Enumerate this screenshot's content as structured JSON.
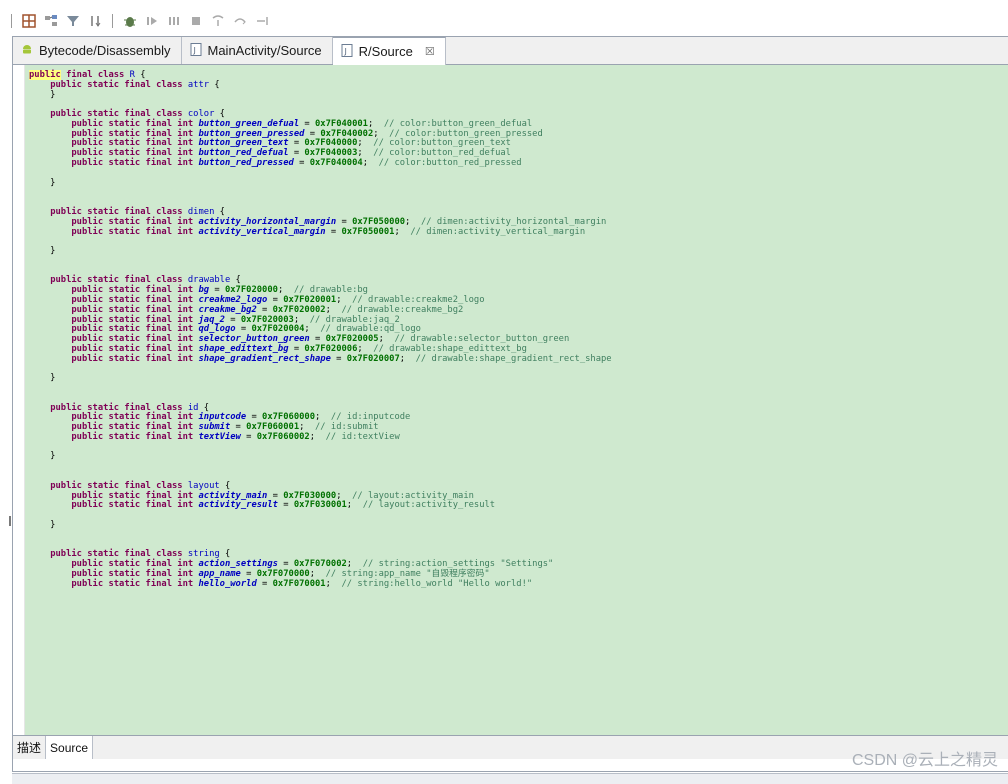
{
  "toolbar": {
    "icons": [
      "separator-mark",
      "grid-icon",
      "hierarchy-icon",
      "filter-icon",
      "sort-icon",
      "debug-icon",
      "resume-icon",
      "columns-icon",
      "stop-icon",
      "step-into-icon",
      "step-over-icon",
      "step-return-icon"
    ]
  },
  "editor": {
    "tabs": [
      {
        "label": "Bytecode/Disassembly",
        "icon": "android-icon",
        "active": false
      },
      {
        "label": "MainActivity/Source",
        "icon": "java-file-icon",
        "active": false
      },
      {
        "label": "R/Source",
        "icon": "java-file-icon",
        "active": true,
        "close": "☒"
      }
    ]
  },
  "code": [
    [
      [
        "kw-hl",
        "public"
      ],
      [
        "kw",
        " final class "
      ],
      [
        "cls",
        "R"
      ],
      [
        "op",
        " {"
      ]
    ],
    [
      [
        "op",
        "    "
      ],
      [
        "kw",
        "public static final class "
      ],
      [
        "cls",
        "attr"
      ],
      [
        "op",
        " {"
      ]
    ],
    [
      [
        "op",
        "    }"
      ]
    ],
    [],
    [
      [
        "op",
        "    "
      ],
      [
        "kw",
        "public static final class "
      ],
      [
        "cls",
        "color"
      ],
      [
        "op",
        " {"
      ]
    ],
    [
      [
        "op",
        "        "
      ],
      [
        "kw",
        "public static final int "
      ],
      [
        "field",
        "button_green_defual"
      ],
      [
        "op",
        " = "
      ],
      [
        "num",
        "0x7F040001"
      ],
      [
        "op",
        ";  "
      ],
      [
        "cmt",
        "// color:button_green_defual"
      ]
    ],
    [
      [
        "op",
        "        "
      ],
      [
        "kw",
        "public static final int "
      ],
      [
        "field",
        "button_green_pressed"
      ],
      [
        "op",
        " = "
      ],
      [
        "num",
        "0x7F040002"
      ],
      [
        "op",
        ";  "
      ],
      [
        "cmt",
        "// color:button_green_pressed"
      ]
    ],
    [
      [
        "op",
        "        "
      ],
      [
        "kw",
        "public static final int "
      ],
      [
        "field",
        "button_green_text"
      ],
      [
        "op",
        " = "
      ],
      [
        "num",
        "0x7F040000"
      ],
      [
        "op",
        ";  "
      ],
      [
        "cmt",
        "// color:button_green_text"
      ]
    ],
    [
      [
        "op",
        "        "
      ],
      [
        "kw",
        "public static final int "
      ],
      [
        "field",
        "button_red_defual"
      ],
      [
        "op",
        " = "
      ],
      [
        "num",
        "0x7F040003"
      ],
      [
        "op",
        ";  "
      ],
      [
        "cmt",
        "// color:button_red_defual"
      ]
    ],
    [
      [
        "op",
        "        "
      ],
      [
        "kw",
        "public static final int "
      ],
      [
        "field",
        "button_red_pressed"
      ],
      [
        "op",
        " = "
      ],
      [
        "num",
        "0x7F040004"
      ],
      [
        "op",
        ";  "
      ],
      [
        "cmt",
        "// color:button_red_pressed"
      ]
    ],
    [],
    [
      [
        "op",
        "    }"
      ]
    ],
    [],
    [],
    [
      [
        "op",
        "    "
      ],
      [
        "kw",
        "public static final class "
      ],
      [
        "cls",
        "dimen"
      ],
      [
        "op",
        " {"
      ]
    ],
    [
      [
        "op",
        "        "
      ],
      [
        "kw",
        "public static final int "
      ],
      [
        "field",
        "activity_horizontal_margin"
      ],
      [
        "op",
        " = "
      ],
      [
        "num",
        "0x7F050000"
      ],
      [
        "op",
        ";  "
      ],
      [
        "cmt",
        "// dimen:activity_horizontal_margin"
      ]
    ],
    [
      [
        "op",
        "        "
      ],
      [
        "kw",
        "public static final int "
      ],
      [
        "field",
        "activity_vertical_margin"
      ],
      [
        "op",
        " = "
      ],
      [
        "num",
        "0x7F050001"
      ],
      [
        "op",
        ";  "
      ],
      [
        "cmt",
        "// dimen:activity_vertical_margin"
      ]
    ],
    [],
    [
      [
        "op",
        "    }"
      ]
    ],
    [],
    [],
    [
      [
        "op",
        "    "
      ],
      [
        "kw",
        "public static final class "
      ],
      [
        "cls",
        "drawable"
      ],
      [
        "op",
        " {"
      ]
    ],
    [
      [
        "op",
        "        "
      ],
      [
        "kw",
        "public static final int "
      ],
      [
        "field",
        "bg"
      ],
      [
        "op",
        " = "
      ],
      [
        "num",
        "0x7F020000"
      ],
      [
        "op",
        ";  "
      ],
      [
        "cmt",
        "// drawable:bg"
      ]
    ],
    [
      [
        "op",
        "        "
      ],
      [
        "kw",
        "public static final int "
      ],
      [
        "field",
        "creakme2_logo"
      ],
      [
        "op",
        " = "
      ],
      [
        "num",
        "0x7F020001"
      ],
      [
        "op",
        ";  "
      ],
      [
        "cmt",
        "// drawable:creakme2_logo"
      ]
    ],
    [
      [
        "op",
        "        "
      ],
      [
        "kw",
        "public static final int "
      ],
      [
        "field",
        "creakme_bg2"
      ],
      [
        "op",
        " = "
      ],
      [
        "num",
        "0x7F020002"
      ],
      [
        "op",
        ";  "
      ],
      [
        "cmt",
        "// drawable:creakme_bg2"
      ]
    ],
    [
      [
        "op",
        "        "
      ],
      [
        "kw",
        "public static final int "
      ],
      [
        "field",
        "jaq_2"
      ],
      [
        "op",
        " = "
      ],
      [
        "num",
        "0x7F020003"
      ],
      [
        "op",
        ";  "
      ],
      [
        "cmt",
        "// drawable:jaq_2"
      ]
    ],
    [
      [
        "op",
        "        "
      ],
      [
        "kw",
        "public static final int "
      ],
      [
        "field",
        "qd_logo"
      ],
      [
        "op",
        " = "
      ],
      [
        "num",
        "0x7F020004"
      ],
      [
        "op",
        ";  "
      ],
      [
        "cmt",
        "// drawable:qd_logo"
      ]
    ],
    [
      [
        "op",
        "        "
      ],
      [
        "kw",
        "public static final int "
      ],
      [
        "field",
        "selector_button_green"
      ],
      [
        "op",
        " = "
      ],
      [
        "num",
        "0x7F020005"
      ],
      [
        "op",
        ";  "
      ],
      [
        "cmt",
        "// drawable:selector_button_green"
      ]
    ],
    [
      [
        "op",
        "        "
      ],
      [
        "kw",
        "public static final int "
      ],
      [
        "field",
        "shape_edittext_bg"
      ],
      [
        "op",
        " = "
      ],
      [
        "num",
        "0x7F020006"
      ],
      [
        "op",
        ";  "
      ],
      [
        "cmt",
        "// drawable:shape_edittext_bg"
      ]
    ],
    [
      [
        "op",
        "        "
      ],
      [
        "kw",
        "public static final int "
      ],
      [
        "field",
        "shape_gradient_rect_shape"
      ],
      [
        "op",
        " = "
      ],
      [
        "num",
        "0x7F020007"
      ],
      [
        "op",
        ";  "
      ],
      [
        "cmt",
        "// drawable:shape_gradient_rect_shape"
      ]
    ],
    [],
    [
      [
        "op",
        "    }"
      ]
    ],
    [],
    [],
    [
      [
        "op",
        "    "
      ],
      [
        "kw",
        "public static final class "
      ],
      [
        "cls",
        "id"
      ],
      [
        "op",
        " {"
      ]
    ],
    [
      [
        "op",
        "        "
      ],
      [
        "kw",
        "public static final int "
      ],
      [
        "field",
        "inputcode"
      ],
      [
        "op",
        " = "
      ],
      [
        "num",
        "0x7F060000"
      ],
      [
        "op",
        ";  "
      ],
      [
        "cmt",
        "// id:inputcode"
      ]
    ],
    [
      [
        "op",
        "        "
      ],
      [
        "kw",
        "public static final int "
      ],
      [
        "field",
        "submit"
      ],
      [
        "op",
        " = "
      ],
      [
        "num",
        "0x7F060001"
      ],
      [
        "op",
        ";  "
      ],
      [
        "cmt",
        "// id:submit"
      ]
    ],
    [
      [
        "op",
        "        "
      ],
      [
        "kw",
        "public static final int "
      ],
      [
        "field",
        "textView"
      ],
      [
        "op",
        " = "
      ],
      [
        "num",
        "0x7F060002"
      ],
      [
        "op",
        ";  "
      ],
      [
        "cmt",
        "// id:textView"
      ]
    ],
    [],
    [
      [
        "op",
        "    }"
      ]
    ],
    [],
    [],
    [
      [
        "op",
        "    "
      ],
      [
        "kw",
        "public static final class "
      ],
      [
        "cls",
        "layout"
      ],
      [
        "op",
        " {"
      ]
    ],
    [
      [
        "op",
        "        "
      ],
      [
        "kw",
        "public static final int "
      ],
      [
        "field",
        "activity_main"
      ],
      [
        "op",
        " = "
      ],
      [
        "num",
        "0x7F030000"
      ],
      [
        "op",
        ";  "
      ],
      [
        "cmt",
        "// layout:activity_main"
      ]
    ],
    [
      [
        "op",
        "        "
      ],
      [
        "kw",
        "public static final int "
      ],
      [
        "field",
        "activity_result"
      ],
      [
        "op",
        " = "
      ],
      [
        "num",
        "0x7F030001"
      ],
      [
        "op",
        ";  "
      ],
      [
        "cmt",
        "// layout:activity_result"
      ]
    ],
    [],
    [
      [
        "op",
        "    }"
      ]
    ],
    [],
    [],
    [
      [
        "op",
        "    "
      ],
      [
        "kw",
        "public static final class "
      ],
      [
        "cls",
        "string"
      ],
      [
        "op",
        " {"
      ]
    ],
    [
      [
        "op",
        "        "
      ],
      [
        "kw",
        "public static final int "
      ],
      [
        "field",
        "action_settings"
      ],
      [
        "op",
        " = "
      ],
      [
        "num",
        "0x7F070002"
      ],
      [
        "op",
        ";  "
      ],
      [
        "cmt",
        "// string:action_settings \"Settings\""
      ]
    ],
    [
      [
        "op",
        "        "
      ],
      [
        "kw",
        "public static final int "
      ],
      [
        "field",
        "app_name"
      ],
      [
        "op",
        " = "
      ],
      [
        "num",
        "0x7F070000"
      ],
      [
        "op",
        ";  "
      ],
      [
        "cmt",
        "// string:app_name \"自毁程序密码\""
      ]
    ],
    [
      [
        "op",
        "        "
      ],
      [
        "kw",
        "public static final int "
      ],
      [
        "field",
        "hello_world"
      ],
      [
        "op",
        " = "
      ],
      [
        "num",
        "0x7F070001"
      ],
      [
        "op",
        ";  "
      ],
      [
        "cmt",
        "// string:hello_world \"Hello world!\""
      ]
    ]
  ],
  "bottom_tabs": [
    {
      "label": "描述",
      "active": false
    },
    {
      "label": "Source",
      "active": true
    }
  ],
  "watermark": "CSDN @云上之精灵"
}
